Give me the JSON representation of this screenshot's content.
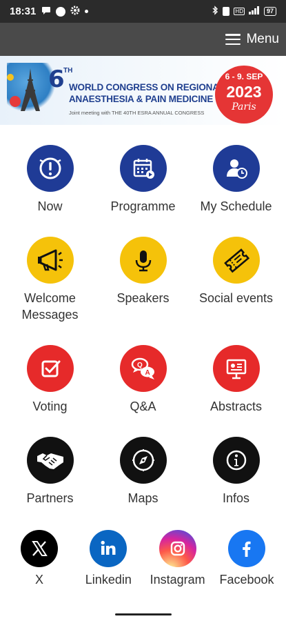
{
  "status_bar": {
    "time": "18:31",
    "battery": "97"
  },
  "header": {
    "menu_label": "Menu"
  },
  "banner": {
    "number": "6",
    "th": "TH",
    "line1": "WORLD CONGRESS ON REGIONAL",
    "line2": "ANAESTHESIA & PAIN MEDICINE",
    "line3": "Joint meeting with THE 40TH ESRA ANNUAL CONGRESS",
    "date": "6 - 9. SEP",
    "year": "2023",
    "city": "Paris"
  },
  "grid": [
    [
      {
        "label": "Now",
        "color": "#1f3b96",
        "icon": "clock-alert-icon"
      },
      {
        "label": "Programme",
        "color": "#1f3b96",
        "icon": "calendar-icon"
      },
      {
        "label": "My Schedule",
        "color": "#1f3b96",
        "icon": "user-schedule-icon"
      }
    ],
    [
      {
        "label": "Welcome Messages",
        "color": "#f5c20a",
        "icon": "megaphone-icon"
      },
      {
        "label": "Speakers",
        "color": "#f5c20a",
        "icon": "microphone-icon"
      },
      {
        "label": "Social events",
        "color": "#f5c20a",
        "icon": "ticket-icon"
      }
    ],
    [
      {
        "label": "Voting",
        "color": "#e62a2a",
        "icon": "checkbox-icon"
      },
      {
        "label": "Q&A",
        "color": "#e62a2a",
        "icon": "chat-bubbles-icon"
      },
      {
        "label": "Abstracts",
        "color": "#e62a2a",
        "icon": "presentation-icon"
      }
    ],
    [
      {
        "label": "Partners",
        "color": "#111111",
        "icon": "handshake-icon"
      },
      {
        "label": "Maps",
        "color": "#111111",
        "icon": "compass-icon"
      },
      {
        "label": "Infos",
        "color": "#111111",
        "icon": "info-icon"
      }
    ]
  ],
  "social": [
    {
      "label": "X",
      "color": "#000000",
      "icon": "x-logo-icon"
    },
    {
      "label": "Linkedin",
      "color": "#0a66c2",
      "icon": "linkedin-logo-icon"
    },
    {
      "label": "Instagram",
      "color": "#d62976",
      "icon": "instagram-logo-icon"
    },
    {
      "label": "Facebook",
      "color": "#1877f2",
      "icon": "facebook-logo-icon"
    }
  ]
}
